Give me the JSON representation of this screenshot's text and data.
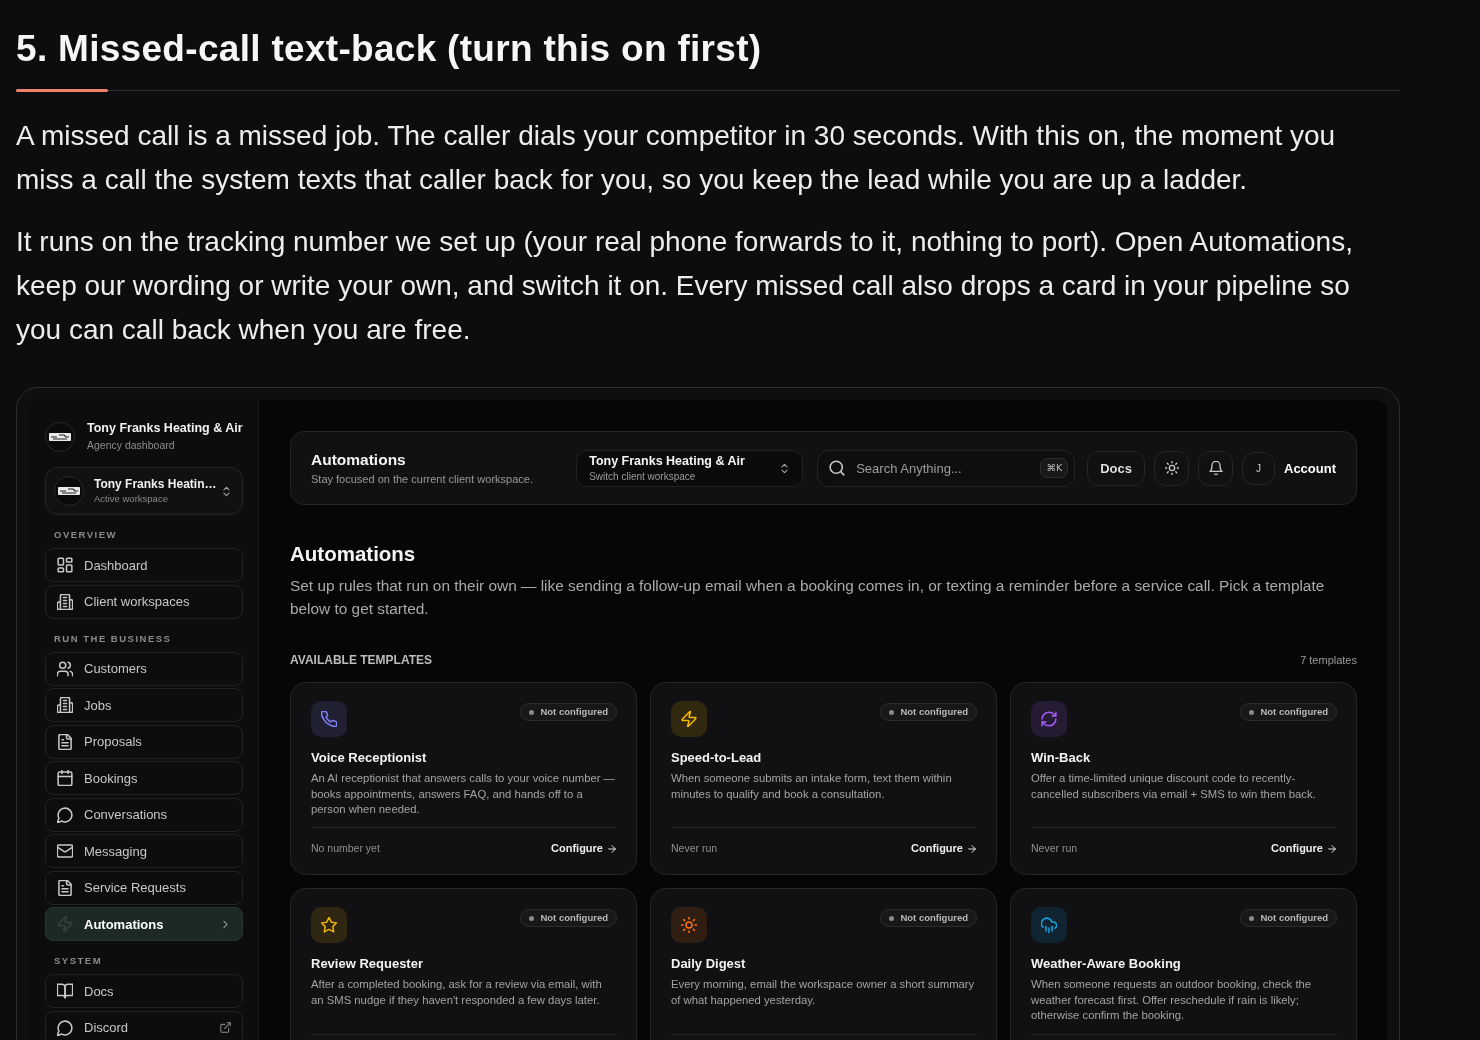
{
  "article": {
    "heading": "5. Missed-call text-back (turn this on first)",
    "paragraphs": [
      "A missed call is a missed job. The caller dials your competitor in 30 seconds. With this on, the moment you miss a call the system texts that caller back for you, so you keep the lead while you are up a ladder.",
      "It runs on the tracking number we set up (your real phone forwards to it, nothing to port). Open Automations, keep our wording or write your own, and switch it on. Every missed call also drops a card in your pipeline so you can call back when you are free."
    ]
  },
  "app": {
    "sidebar": {
      "org": {
        "name": "Tony Franks Heating & Air",
        "subtitle": "Agency dashboard"
      },
      "workspace": {
        "name": "Tony Franks Heatin…",
        "subtitle": "Active workspace"
      },
      "sections": [
        {
          "label": "OVERVIEW",
          "items": [
            {
              "label": "Dashboard",
              "selected": false,
              "external": false
            },
            {
              "label": "Client workspaces",
              "selected": false,
              "external": false
            }
          ]
        },
        {
          "label": "RUN THE BUSINESS",
          "items": [
            {
              "label": "Customers",
              "selected": false,
              "external": false
            },
            {
              "label": "Jobs",
              "selected": false,
              "external": false
            },
            {
              "label": "Proposals",
              "selected": false,
              "external": false
            },
            {
              "label": "Bookings",
              "selected": false,
              "external": false
            },
            {
              "label": "Conversations",
              "selected": false,
              "external": false
            },
            {
              "label": "Messaging",
              "selected": false,
              "external": false
            },
            {
              "label": "Service Requests",
              "selected": false,
              "external": false
            },
            {
              "label": "Automations",
              "selected": true,
              "external": false
            }
          ]
        },
        {
          "label": "SYSTEM",
          "items": [
            {
              "label": "Docs",
              "selected": false,
              "external": false
            },
            {
              "label": "Discord",
              "selected": false,
              "external": true
            }
          ]
        }
      ]
    },
    "topbar": {
      "title": "Automations",
      "subtitle": "Stay focused on the current client workspace.",
      "workspace_switch": {
        "name": "Tony Franks Heating & Air",
        "subtitle": "Switch client workspace"
      },
      "search": {
        "placeholder": "Search Anything...",
        "shortcut": "⌘K"
      },
      "docs_button": "Docs",
      "avatar": "J",
      "account": "Account"
    },
    "page": {
      "title": "Automations",
      "description": "Set up rules that run on their own — like sending a follow-up email when a booking comes in, or texting a reminder before a service call. Pick a template below to get started.",
      "section_label": "AVAILABLE TEMPLATES",
      "count": "7 templates",
      "templates": [
        {
          "title": "Voice Receptionist",
          "description": "An AI receptionist that answers calls to your voice number — books appointments, answers FAQ, and hands off to a person when needed.",
          "status": "Not configured",
          "color": "#7c80f2",
          "footer_note": "No number yet",
          "action": "Configure"
        },
        {
          "title": "Speed-to-Lead",
          "description": "When someone submits an intake form, text them within minutes to qualify and book a consultation.",
          "status": "Not configured",
          "color": "#f5b800",
          "footer_note": "Never run",
          "action": "Configure"
        },
        {
          "title": "Win-Back",
          "description": "Offer a time-limited unique discount code to recently-cancelled subscribers via email + SMS to win them back.",
          "status": "Not configured",
          "color": "#a35cf5",
          "footer_note": "Never run",
          "action": "Configure"
        },
        {
          "title": "Review Requester",
          "description": "After a completed booking, ask for a review via email, with an SMS nudge if they haven't responded a few days later.",
          "status": "Not configured",
          "color": "#eab308"
        },
        {
          "title": "Daily Digest",
          "description": "Every morning, email the workspace owner a short summary of what happened yesterday.",
          "status": "Not configured",
          "color": "#f97316"
        },
        {
          "title": "Weather-Aware Booking",
          "description": "When someone requests an outdoor booking, check the weather forecast first. Offer reschedule if rain is likely; otherwise confirm the booking.",
          "status": "Not configured",
          "color": "#0ea5e9"
        }
      ]
    }
  }
}
